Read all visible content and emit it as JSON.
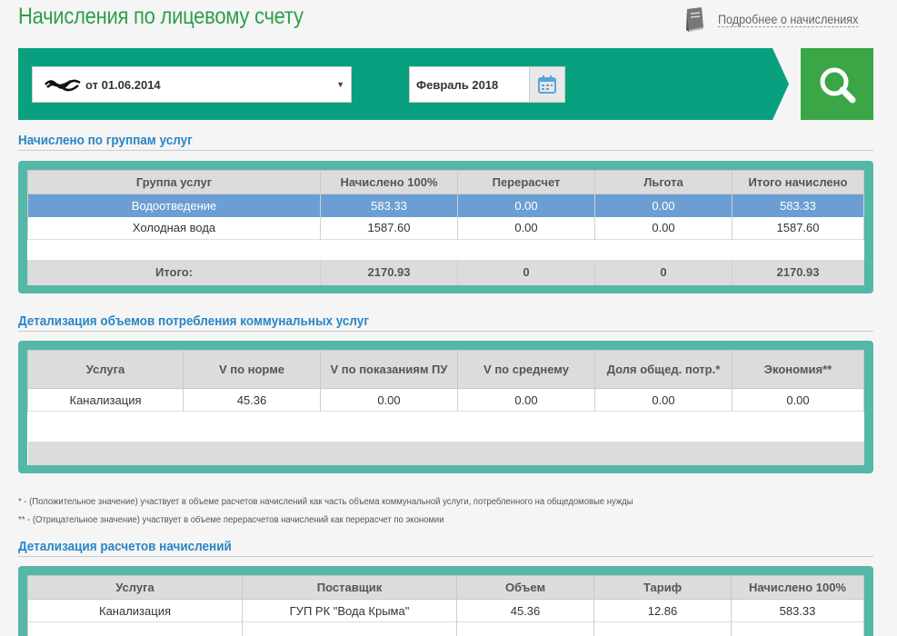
{
  "header": {
    "title": "Начисления по лицевому счету",
    "more_link": "Подробнее о начислениях"
  },
  "filter": {
    "account_suffix": "от 01.06.2014",
    "period_value": "Февраль 2018"
  },
  "colors": {
    "accent_teal": "#08a07e",
    "search_green": "#3aa645",
    "panel": "#55b7a7",
    "title_green": "#2e9e4a",
    "section_blue": "#2a86c6",
    "selected_row": "#6b9fd4"
  },
  "groups": {
    "title": "Начислено по группам услуг",
    "headers": [
      "Группа услуг",
      "Начислено 100%",
      "Перерасчет",
      "Льгота",
      "Итого начислено"
    ],
    "rows": [
      [
        "Водоотведение",
        "583.33",
        "0.00",
        "0.00",
        "583.33"
      ],
      [
        "Холодная вода",
        "1587.60",
        "0.00",
        "0.00",
        "1587.60"
      ]
    ],
    "total": [
      "Итого:",
      "2170.93",
      "0",
      "0",
      "2170.93"
    ]
  },
  "volumes": {
    "title": "Детализация объемов потребления коммунальных услуг",
    "headers": [
      "Услуга",
      "V по норме",
      "V по показаниям ПУ",
      "V по среднему",
      "Доля общед. потр.*",
      "Экономия**"
    ],
    "rows": [
      [
        "Канализация",
        "45.36",
        "0.00",
        "0.00",
        "0.00",
        "0.00"
      ]
    ]
  },
  "footnotes": {
    "one": "* - (Положительное значение) участвует в объеме расчетов начислений как часть объема коммунальной услуги, потребленного на общедомовые нужды",
    "two": "** - (Отрицательное значение) участвует в объеме перерасчетов начислений как перерасчет по экономии"
  },
  "calc": {
    "title": "Детализация расчетов начислений",
    "headers": [
      "Услуга",
      "Поставщик",
      "Объем",
      "Тариф",
      "Начислено 100%"
    ],
    "rows": [
      [
        "Канализация",
        "ГУП РК \"Вода Крыма\"",
        "45.36",
        "12.86",
        "583.33"
      ]
    ]
  }
}
